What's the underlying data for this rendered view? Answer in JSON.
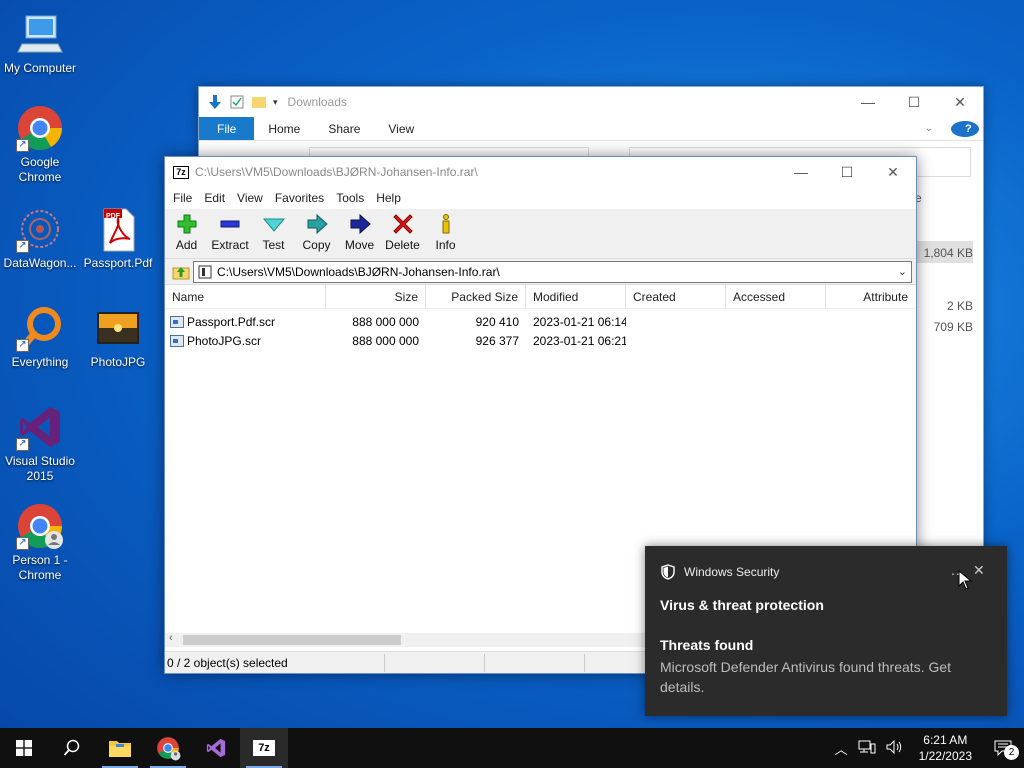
{
  "desktop": {
    "icons": [
      {
        "label": "My Computer"
      },
      {
        "label": "Google Chrome"
      },
      {
        "label": "DataWagon..."
      },
      {
        "label": "Passport.Pdf"
      },
      {
        "label": "Everything"
      },
      {
        "label": "PhotoJPG"
      },
      {
        "label": "Visual Studio 2015"
      },
      {
        "label": "Person 1 - Chrome"
      }
    ],
    "pdf_badge": "PDF"
  },
  "explorer": {
    "title": "Downloads",
    "ribbon_tabs": [
      "File",
      "Home",
      "Share",
      "View"
    ],
    "partial_col": "e",
    "partial_size": "1,804 KB",
    "sizes": [
      "2 KB",
      "709 KB"
    ]
  },
  "sevenzip": {
    "app_icon_text": "7z",
    "title": "C:\\Users\\VM5\\Downloads\\BJØRN-Johansen-Info.rar\\",
    "menu": [
      "File",
      "Edit",
      "View",
      "Favorites",
      "Tools",
      "Help"
    ],
    "toolbar": [
      "Add",
      "Extract",
      "Test",
      "Copy",
      "Move",
      "Delete",
      "Info"
    ],
    "address": "C:\\Users\\VM5\\Downloads\\BJØRN-Johansen-Info.rar\\",
    "columns": [
      "Name",
      "Size",
      "Packed Size",
      "Modified",
      "Created",
      "Accessed",
      "Attribute"
    ],
    "rows": [
      {
        "name": "Passport.Pdf.scr",
        "size": "888 000 000",
        "packed": "920 410",
        "modified": "2023-01-21 06:14",
        "created": "",
        "accessed": ""
      },
      {
        "name": "PhotoJPG.scr",
        "size": "888 000 000",
        "packed": "926 377",
        "modified": "2023-01-21 06:21",
        "created": "",
        "accessed": ""
      }
    ],
    "status": "0 / 2 object(s) selected"
  },
  "toast": {
    "app": "Windows Security",
    "title": "Virus & threat protection",
    "subtitle": "Threats found",
    "body": "Microsoft Defender Antivirus found threats. Get details.",
    "more": "...",
    "close": "✕"
  },
  "taskbar": {
    "time": "6:21 AM",
    "date": "1/22/2023",
    "notifications": "2",
    "sevenzip_icon_text": "7z"
  }
}
